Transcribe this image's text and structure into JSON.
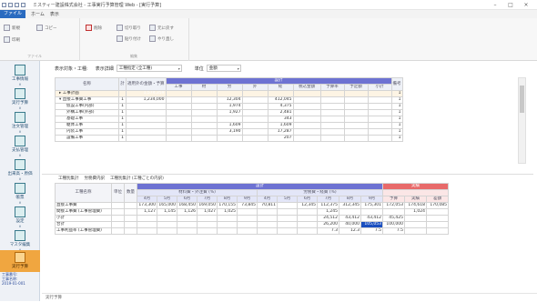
{
  "window": {
    "title": "ミスティー建設株式会社 - 工事実行予算管理 Web - [実行予算]",
    "minimize": "–",
    "maximize": "□",
    "close": "×"
  },
  "menu": {
    "file": "ファイル",
    "tabs": [
      "ホーム",
      "表示"
    ]
  },
  "ribbon": {
    "new_label": "新規",
    "print_label": "印刷",
    "copy_label": "コピー",
    "paste_label": "貼り付け",
    "delete_label": "削除",
    "cut_label": "切り取り",
    "undo_label": "元に戻す",
    "redo_label": "やり直し",
    "group_file": "ファイル",
    "group_edit": "編集"
  },
  "sidebar": {
    "items": [
      {
        "label": "工事情報"
      },
      {
        "label": "実行予算"
      },
      {
        "label": "注文管理"
      },
      {
        "label": "支払管理"
      },
      {
        "label": "出来高・原価"
      },
      {
        "label": "帳票"
      },
      {
        "label": "設定"
      },
      {
        "label": "マスタ編集"
      },
      {
        "label": "実行予算"
      }
    ],
    "footer_lines": [
      "工事番号:",
      "工事名称:",
      "2019-01-001"
    ]
  },
  "filter": {
    "label": "表示対象・工種:",
    "type_label": "表示詳細",
    "type_value": "工種指定 (全工種)",
    "unit_label": "単位",
    "unit_value": "金額"
  },
  "upper_table": {
    "band_label": "設計",
    "headers": [
      "名称",
      "計",
      "適用外の金額・予算",
      "工事",
      "材",
      "労",
      "外",
      "経",
      "税込金額",
      "予算率",
      "予定額",
      "小計",
      "備考"
    ],
    "rows": [
      {
        "name": "▸ 工事計画",
        "c1": "",
        "c2": "1,574,359",
        "c3": "",
        "c4": "",
        "c5": "",
        "c6": "",
        "c7": "",
        "c8": "",
        "c9": "",
        "c10": "",
        "c11": "1",
        "sel": true
      },
      {
        "name": "▾ 直接工事費工事",
        "c1": "1",
        "c2": "1,234,000",
        "c3": "",
        "c4": "12,304",
        "c5": "",
        "c6": "412,045",
        "c7": "",
        "c8": "",
        "c9": "",
        "c10": "",
        "c11": "1"
      },
      {
        "name": "仮設工事(内部)",
        "c1": "1",
        "c2": "",
        "c3": "",
        "c4": "1,974",
        "c5": "",
        "c6": "4,375",
        "c7": "",
        "c8": "",
        "c9": "",
        "c10": "",
        "c11": "1"
      },
      {
        "name": "外構工事(外部)",
        "c1": "1",
        "c2": "",
        "c3": "",
        "c4": "1,927",
        "c5": "",
        "c6": "2,481",
        "c7": "",
        "c8": "",
        "c9": "",
        "c10": "",
        "c11": "1"
      },
      {
        "name": "基礎工事",
        "c1": "1",
        "c2": "",
        "c3": "",
        "c4": "",
        "c5": "",
        "c6": "343",
        "c7": "",
        "c8": "",
        "c9": "",
        "c10": "",
        "c11": "1"
      },
      {
        "name": "躯体工事",
        "c1": "1",
        "c2": "",
        "c3": "",
        "c4": "1,609",
        "c5": "",
        "c6": "1,609",
        "c7": "",
        "c8": "",
        "c9": "",
        "c10": "",
        "c11": "1"
      },
      {
        "name": "内装工事",
        "c1": "1",
        "c2": "",
        "c3": "",
        "c4": "3,190",
        "c5": "",
        "c6": "17,287",
        "c7": "",
        "c8": "",
        "c9": "",
        "c10": "",
        "c11": "1"
      },
      {
        "name": "設備工事",
        "c1": "1",
        "c2": "",
        "c3": "",
        "c4": "",
        "c5": "",
        "c6": "207",
        "c7": "",
        "c8": "",
        "c9": "",
        "c10": "",
        "c11": "1"
      }
    ]
  },
  "lower_bar": {
    "items": [
      "工種別集計",
      "労務費内訳",
      "工種別集計 (工種ごとの内訳)"
    ]
  },
  "lower_table": {
    "band_a": "設計",
    "band_b": "実績",
    "group_a1": "材料費・外注費 (%)",
    "group_a2": "労務費・経費 (%)",
    "headers_left": [
      "工種名称",
      "単位",
      "数量"
    ],
    "sub_headers": [
      "4月",
      "5月",
      "6月",
      "7月",
      "8月",
      "9月",
      "4月",
      "5月",
      "6月",
      "7月",
      "8月",
      "9月",
      "予算",
      "実績",
      "差額"
    ],
    "rows": [
      {
        "name": "直接工事費",
        "v": [
          "",
          "",
          "173,300",
          "165,000",
          "168,450",
          "169,050",
          "170,155",
          "73,845",
          "70,811",
          "",
          "12,345",
          "112,375",
          "312,345",
          "175,301",
          "172,053",
          "174,618",
          "170,085",
          "173,053"
        ]
      },
      {
        "name": "間接工事費 (工事管理費)",
        "v": [
          "",
          "",
          "1,127",
          "1,145",
          "1,126",
          "1,027",
          "1,025",
          "",
          "",
          "",
          "",
          "1,245",
          "",
          "",
          "",
          "1,024",
          "",
          "1,024"
        ]
      },
      {
        "name": "小計",
        "v": [
          "",
          "",
          "",
          "",
          "",
          "",
          "",
          "",
          "",
          "",
          "",
          "24,512",
          "43,412",
          "43,412",
          "45,425",
          "",
          "",
          "46,000"
        ]
      },
      {
        "name": "合計",
        "v": [
          "",
          "",
          "",
          "",
          "",
          "",
          "",
          "",
          "",
          "",
          "",
          "26,200",
          "40,000",
          "105,053",
          "100,000",
          "",
          "",
          "100,000"
        ]
      },
      {
        "name": "工事利益率 (工事管理費)",
        "v": [
          "",
          "",
          "",
          "",
          "",
          "",
          "",
          "",
          "",
          "",
          "",
          "7.3",
          "12.3",
          "7.5",
          "7.5",
          "",
          "",
          "7.3"
        ]
      }
    ]
  },
  "status": {
    "text": "実行予算"
  }
}
